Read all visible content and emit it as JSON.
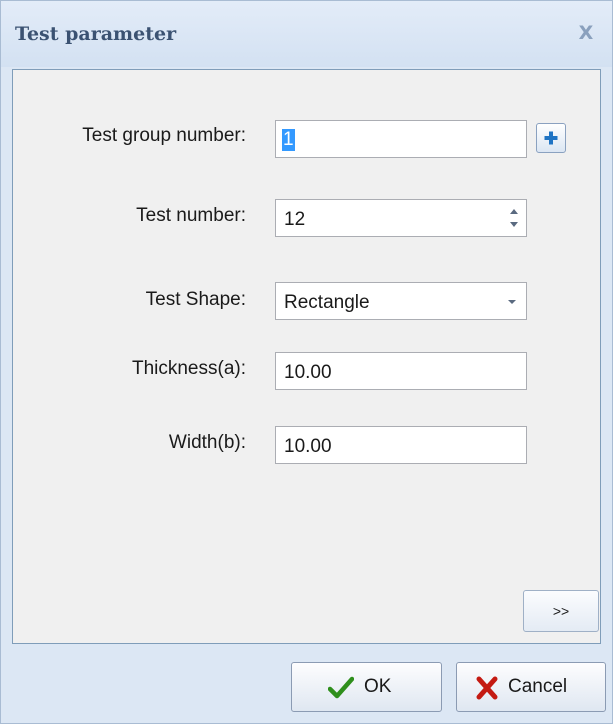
{
  "dialog": {
    "title": "Test parameter",
    "close_glyph": "X"
  },
  "form": {
    "group_number": {
      "label": "Test group number:",
      "value": "1",
      "add_icon": "plus-icon"
    },
    "test_number": {
      "label": "Test number:",
      "value": "12",
      "spinner_icons": [
        "spin-up-arrow-icon",
        "spin-down-arrow-icon"
      ]
    },
    "test_shape": {
      "label": "Test Shape:",
      "selected": "Rectangle",
      "dropdown_icon": "dropdown-arrow-icon"
    },
    "thickness": {
      "label": "Thickness(a):",
      "value": "10.00"
    },
    "width": {
      "label": "Width(b):",
      "value": "10.00"
    }
  },
  "buttons": {
    "more": ">>",
    "ok": "OK",
    "cancel": "Cancel",
    "ok_icon": "checkmark-icon",
    "cancel_icon": "red-x-icon"
  },
  "colors": {
    "title_text": "#3b5272",
    "dialog_background": "#dce7f4",
    "panel_background": "#f0f0f0",
    "selection_highlight": "#3399ff",
    "plus_icon": "#1f74c4",
    "ok_check": "#2f8f1c",
    "cancel_x": "#c41a12"
  }
}
